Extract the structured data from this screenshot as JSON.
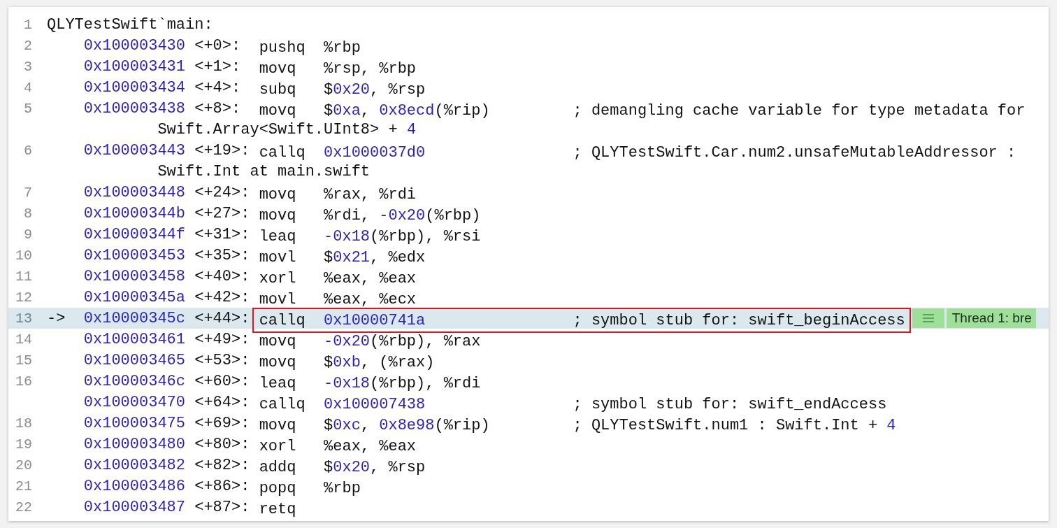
{
  "disassembly": {
    "lines": [
      {
        "kind": "label",
        "number": "1",
        "text": "QLYTestSwift`main:"
      },
      {
        "kind": "instruction",
        "number": "2",
        "current": false,
        "annotated": false,
        "address": "0x100003430",
        "offset": "<+0>:",
        "mnemonic": "pushq",
        "operands": "%rbp"
      },
      {
        "kind": "instruction",
        "number": "3",
        "current": false,
        "annotated": false,
        "address": "0x100003431",
        "offset": "<+1>:",
        "mnemonic": "movq",
        "operands": "%rsp, %rbp"
      },
      {
        "kind": "instruction",
        "number": "4",
        "current": false,
        "annotated": false,
        "address": "0x100003434",
        "offset": "<+4>:",
        "mnemonic": "subq",
        "operands": "$0x20, %rsp"
      },
      {
        "kind": "instruction",
        "number": "5",
        "current": false,
        "annotated": false,
        "address": "0x100003438",
        "offset": "<+8>:",
        "mnemonic": "movq",
        "operands": "$0xa, 0x8ecd(%rip)",
        "comment": "; demangling cache variable for type metadata for",
        "comment_wrap": "Swift.Array<Swift.UInt8> + 4"
      },
      {
        "kind": "instruction",
        "number": "6",
        "current": false,
        "annotated": false,
        "address": "0x100003443",
        "offset": "<+19>:",
        "mnemonic": "callq",
        "operands": "0x1000037d0",
        "comment": "; QLYTestSwift.Car.num2.unsafeMutableAddressor :",
        "comment_wrap": "Swift.Int at main.swift"
      },
      {
        "kind": "instruction",
        "number": "7",
        "current": false,
        "annotated": false,
        "address": "0x100003448",
        "offset": "<+24>:",
        "mnemonic": "movq",
        "operands": "%rax, %rdi"
      },
      {
        "kind": "instruction",
        "number": "8",
        "current": false,
        "annotated": false,
        "address": "0x10000344b",
        "offset": "<+27>:",
        "mnemonic": "movq",
        "operands": "%rdi, -0x20(%rbp)"
      },
      {
        "kind": "instruction",
        "number": "9",
        "current": false,
        "annotated": false,
        "address": "0x10000344f",
        "offset": "<+31>:",
        "mnemonic": "leaq",
        "operands": "-0x18(%rbp), %rsi"
      },
      {
        "kind": "instruction",
        "number": "10",
        "current": false,
        "annotated": false,
        "address": "0x100003453",
        "offset": "<+35>:",
        "mnemonic": "movl",
        "operands": "$0x21, %edx"
      },
      {
        "kind": "instruction",
        "number": "11",
        "current": false,
        "annotated": false,
        "address": "0x100003458",
        "offset": "<+40>:",
        "mnemonic": "xorl",
        "operands": "%eax, %eax"
      },
      {
        "kind": "instruction",
        "number": "12",
        "current": false,
        "annotated": false,
        "address": "0x10000345a",
        "offset": "<+42>:",
        "mnemonic": "movl",
        "operands": "%eax, %ecx"
      },
      {
        "kind": "instruction",
        "number": "13",
        "current": true,
        "pc_arrow": "->",
        "annotated": true,
        "address": "0x10000345c",
        "offset": "<+44>:",
        "mnemonic": "callq",
        "operands": "0x10000741a",
        "comment": "; symbol stub for: swift_beginAccess",
        "thread_badge": "Thread 1: bre"
      },
      {
        "kind": "instruction",
        "number": "14",
        "current": false,
        "annotated": false,
        "address": "0x100003461",
        "offset": "<+49>:",
        "mnemonic": "movq",
        "operands": "-0x20(%rbp), %rax"
      },
      {
        "kind": "instruction",
        "number": "15",
        "current": false,
        "annotated": false,
        "address": "0x100003465",
        "offset": "<+53>:",
        "mnemonic": "movq",
        "operands": "$0xb, (%rax)"
      },
      {
        "kind": "instruction",
        "number": "16",
        "current": false,
        "annotated": false,
        "address": "0x10000346c",
        "offset": "<+60>:",
        "mnemonic": "leaq",
        "operands": "-0x18(%rbp), %rdi"
      },
      {
        "kind": "instruction",
        "current": false,
        "annotated": false,
        "address": "0x100003470",
        "offset": "<+64>:",
        "mnemonic": "callq",
        "operands": "0x100007438",
        "comment": "; symbol stub for: swift_endAccess"
      },
      {
        "kind": "instruction",
        "number": "18",
        "current": false,
        "annotated": false,
        "address": "0x100003475",
        "offset": "<+69>:",
        "mnemonic": "movq",
        "operands": "$0xc, 0x8e98(%rip)",
        "comment": "; QLYTestSwift.num1 : Swift.Int + 4"
      },
      {
        "kind": "instruction",
        "number": "19",
        "current": false,
        "annotated": false,
        "address": "0x100003480",
        "offset": "<+80>:",
        "mnemonic": "xorl",
        "operands": "%eax, %eax"
      },
      {
        "kind": "instruction",
        "number": "20",
        "current": false,
        "annotated": false,
        "address": "0x100003482",
        "offset": "<+82>:",
        "mnemonic": "addq",
        "operands": "$0x20, %rsp"
      },
      {
        "kind": "instruction",
        "number": "21",
        "current": false,
        "annotated": false,
        "address": "0x100003486",
        "offset": "<+86>:",
        "mnemonic": "popq",
        "operands": "%rbp"
      },
      {
        "kind": "instruction",
        "number": "22",
        "current": false,
        "annotated": false,
        "address": "0x100003487",
        "offset": "<+87>:",
        "mnemonic": "retq"
      }
    ]
  }
}
